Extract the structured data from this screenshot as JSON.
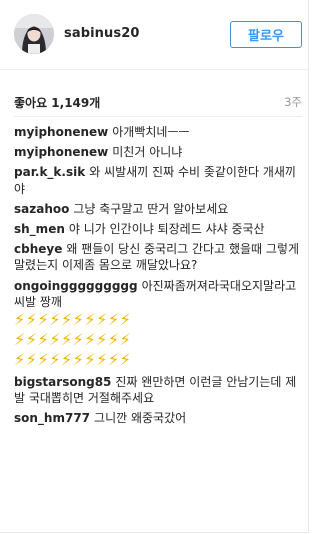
{
  "header": {
    "username": "sabinus20",
    "follow_label": "팔로우"
  },
  "likes": {
    "label": "좋아요 1,149개",
    "time": "3주"
  },
  "comments": [
    {
      "user": "myiphonenew",
      "text": "아개빡치네ㅡㅡ"
    },
    {
      "user": "myiphonenew",
      "text": "미친거 아니냐"
    },
    {
      "user": "par.k_k.sik",
      "text": "와 씨발새끼 진짜 수비 좆같이한다 개새끼야"
    },
    {
      "user": "sazahoo",
      "text": "그냥 축구말고 딴거 알아보세요"
    },
    {
      "user": "sh_men",
      "text": "야 니가 인간이냐 퇴장레드 샤샤 중국산"
    },
    {
      "user": "cbheye",
      "text": "왜 팬들이 당신 중국리그 간다고 했을때 그렇게 말렸는지 이제좀 몸으로 깨달았나요?"
    },
    {
      "user": "ongoinggggggggg",
      "text": "아진짜좀꺼져라국대오지말라고 씨발 짱깨",
      "bolts": [
        "⚡⚡⚡⚡⚡⚡⚡⚡⚡⚡",
        "⚡⚡⚡⚡⚡⚡⚡⚡⚡⚡",
        "⚡⚡⚡⚡⚡⚡⚡⚡⚡⚡"
      ]
    },
    {
      "user": "bigstarsong85",
      "text": "진짜 왠만하면 이런글 안남기는데 제발 국대뽑히면 거절해주세요"
    },
    {
      "user": "son_hm777",
      "text": "그니깐 왜중국갔어"
    }
  ]
}
